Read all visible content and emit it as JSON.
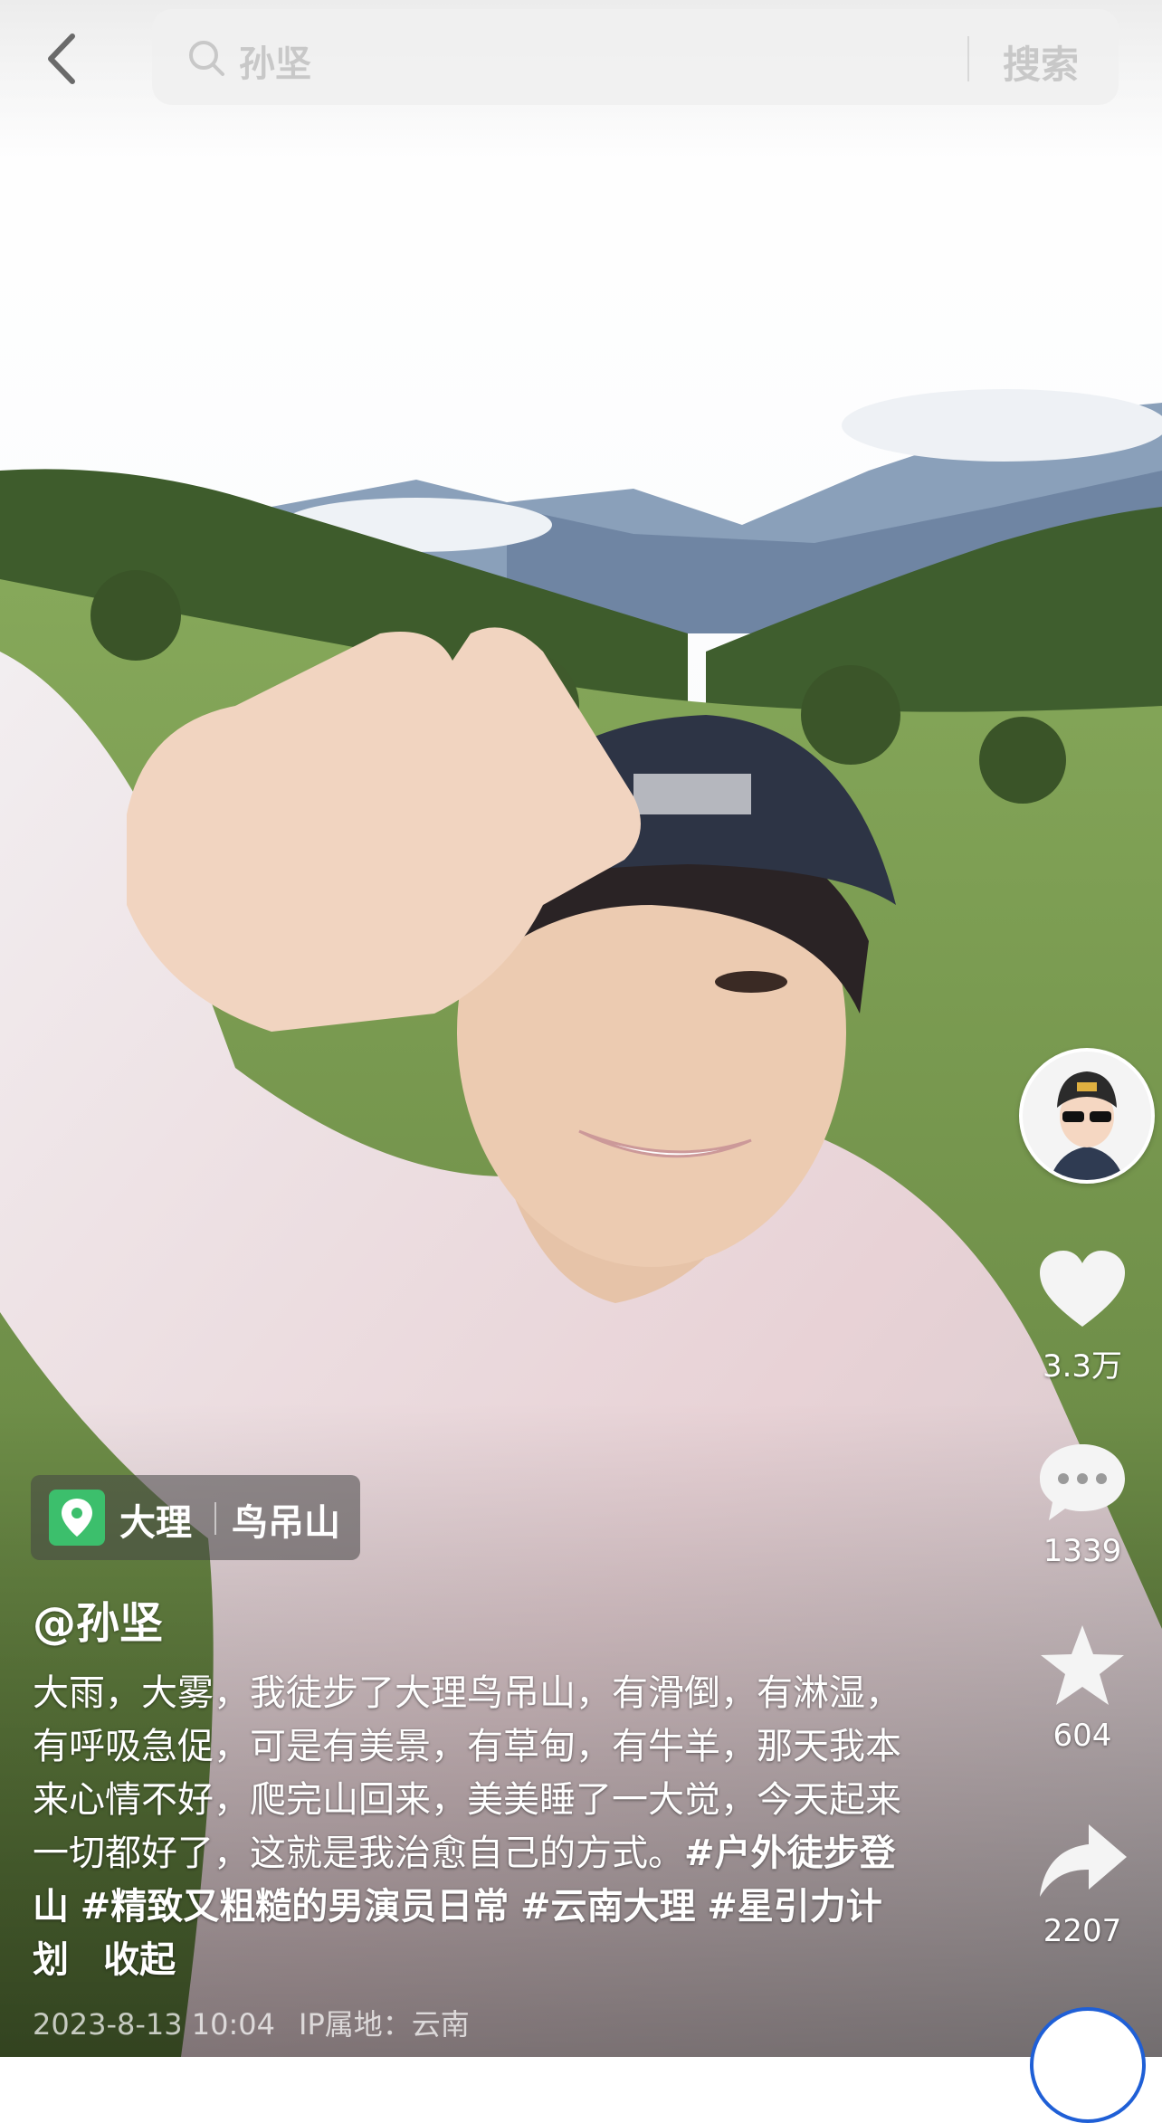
{
  "search": {
    "query": "孙坚",
    "button_label": "搜索"
  },
  "actions": {
    "likes": "3.3万",
    "comments": "1339",
    "favorites": "604",
    "shares": "2207"
  },
  "location": {
    "city": "大理",
    "poi": "鸟吊山"
  },
  "post": {
    "author": "@孙坚",
    "text": "大雨，大雾，我徒步了大理鸟吊山，有滑倒，有淋湿，有呼吸急促，可是有美景，有草甸，有牛羊，那天我本来心情不好，爬完山回来，美美睡了一大觉，今天起来一切都好了，这就是我治愈自己的方式。",
    "hashtags": [
      "#户外徒步登山",
      "#精致又粗糙的男演员日常",
      "#云南大理",
      "#星引力计划"
    ],
    "collapse_label": "收起",
    "timestamp": "2023-8-13 10:04",
    "ip_location": "IP属地：云南"
  },
  "icons": {
    "back": "chevron-left-icon",
    "search": "search-icon",
    "like": "heart-icon",
    "comment": "comment-bubble-icon",
    "favorite": "star-icon",
    "share": "share-arrow-icon",
    "location": "location-pin-icon"
  },
  "colors": {
    "location_pin": "#3cbf6c",
    "text": "#ffffff"
  }
}
